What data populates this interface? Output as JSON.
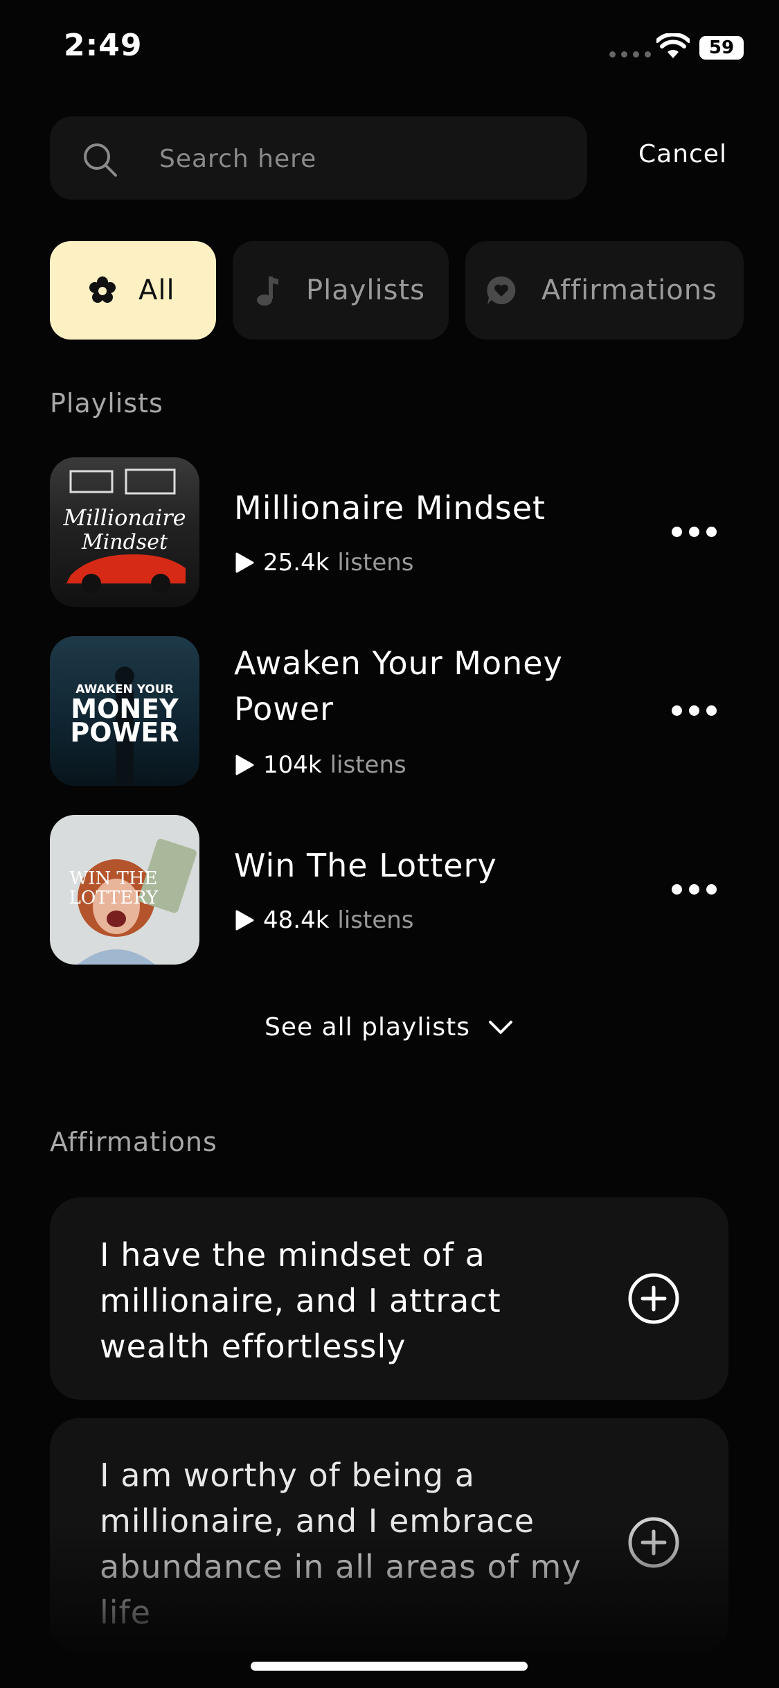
{
  "status_bar": {
    "time": "2:49",
    "battery": "59"
  },
  "search": {
    "placeholder": "Search here",
    "cancel_label": "Cancel"
  },
  "filters": [
    {
      "label": "All",
      "icon": "flower-icon",
      "selected": true
    },
    {
      "label": "Playlists",
      "icon": "music-note-icon",
      "selected": false
    },
    {
      "label": "Affirmations",
      "icon": "chat-heart-icon",
      "selected": false
    }
  ],
  "playlists_section": {
    "title": "Playlists",
    "items": [
      {
        "title": "Millionaire Mindset",
        "listens_count": "25.4k",
        "listens_word": "listens",
        "cover_text": "Millionaire Mindset"
      },
      {
        "title": "Awaken Your Money Power",
        "listens_count": "104k",
        "listens_word": "listens",
        "cover_text_small": "AWAKEN YOUR",
        "cover_text_big1": "MONEY",
        "cover_text_big2": "POWER"
      },
      {
        "title": "Win The Lottery",
        "listens_count": "48.4k",
        "listens_word": "listens",
        "cover_text": "WIN THE LOTTERY"
      }
    ],
    "see_all_label": "See all playlists"
  },
  "affirmations_section": {
    "title": "Affirmations",
    "items": [
      {
        "text": "I have the mindset of a millionaire, and I attract wealth effortlessly"
      },
      {
        "text": "I am worthy of being a millionaire, and I embrace abundance in all areas of my life"
      }
    ]
  },
  "colors": {
    "background": "#050505",
    "chip_selected": "#fdf1c4",
    "card": "#131313"
  }
}
